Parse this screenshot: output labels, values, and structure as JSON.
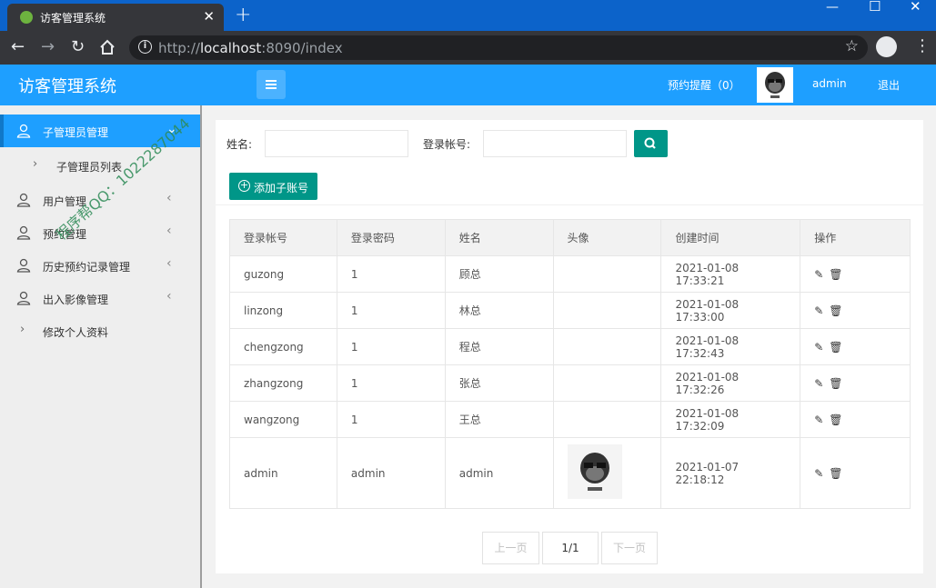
{
  "browser": {
    "tab_title": "访客管理系统",
    "close_glyph": "✕",
    "newtab_glyph": "+",
    "url_prefix": "http://",
    "url_host": "localhost",
    "url_rest": ":8090/index"
  },
  "header": {
    "title": "访客管理系统",
    "reminder": "预约提醒（0）",
    "username": "admin",
    "logout": "退出"
  },
  "sidebar": {
    "items": [
      {
        "label": "子管理员管理"
      },
      {
        "label": "子管理员列表"
      },
      {
        "label": "用户管理"
      },
      {
        "label": "预约管理"
      },
      {
        "label": "历史预约记录管理"
      },
      {
        "label": "出入影像管理"
      },
      {
        "label": "修改个人资料"
      }
    ],
    "watermark": "程序帮QQ：1022287044"
  },
  "search": {
    "name_label": "姓名:",
    "account_label": "登录帐号:",
    "name_value": "",
    "account_value": ""
  },
  "add_button": "添加子账号",
  "table": {
    "headers": [
      "登录帐号",
      "登录密码",
      "姓名",
      "头像",
      "创建时间",
      "操作"
    ],
    "rows": [
      {
        "account": "guzong",
        "password": "1",
        "name": "顾总",
        "created": "2021-01-08 17:33:21"
      },
      {
        "account": "linzong",
        "password": "1",
        "name": "林总",
        "created": "2021-01-08 17:33:00"
      },
      {
        "account": "chengzong",
        "password": "1",
        "name": "程总",
        "created": "2021-01-08 17:32:43"
      },
      {
        "account": "zhangzong",
        "password": "1",
        "name": "张总",
        "created": "2021-01-08 17:32:26"
      },
      {
        "account": "wangzong",
        "password": "1",
        "name": "王总",
        "created": "2021-01-08 17:32:09"
      },
      {
        "account": "admin",
        "password": "admin",
        "name": "admin",
        "created": "2021-01-07 22:18:12"
      }
    ]
  },
  "pager": {
    "prev": "上一页",
    "current": "1/1",
    "next": "下一页"
  },
  "colors": {
    "header_blue": "#1e9fff",
    "teal": "#009688"
  }
}
